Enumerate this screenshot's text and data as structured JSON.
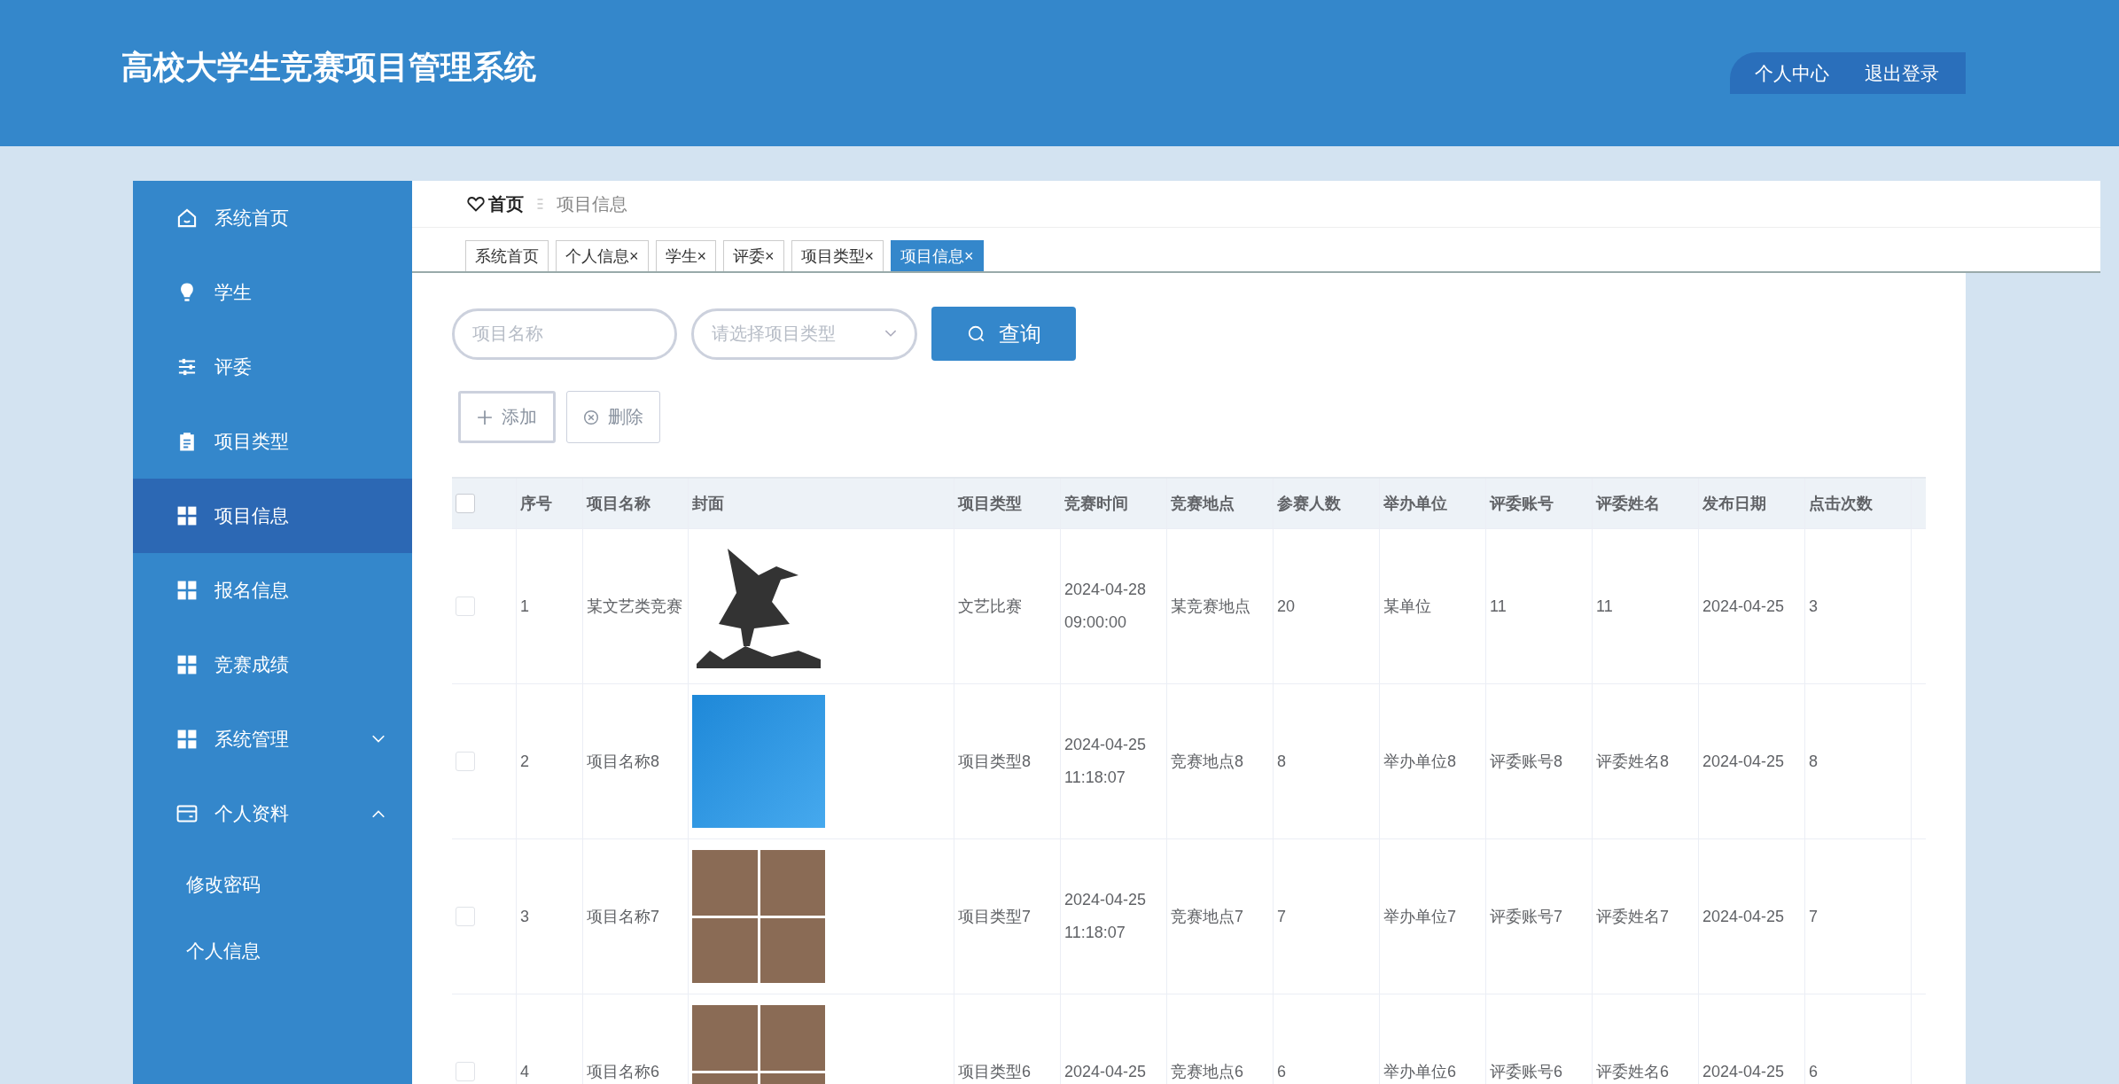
{
  "header": {
    "title": "高校大学生竞赛项目管理系统",
    "links": [
      "个人中心",
      "退出登录"
    ]
  },
  "sidebar": {
    "items": [
      {
        "label": "系统首页",
        "kind": "home",
        "selected": false
      },
      {
        "label": "学生",
        "kind": "bulb",
        "selected": false
      },
      {
        "label": "评委",
        "kind": "sliders",
        "selected": false
      },
      {
        "label": "项目类型",
        "kind": "clipboard",
        "selected": false
      },
      {
        "label": "项目信息",
        "kind": "grid",
        "selected": true
      },
      {
        "label": "报名信息",
        "kind": "grid",
        "selected": false
      },
      {
        "label": "竞赛成绩",
        "kind": "grid",
        "selected": false
      },
      {
        "label": "系统管理",
        "kind": "grid",
        "selected": false,
        "expanded": false
      },
      {
        "label": "个人资料",
        "kind": "card",
        "selected": false,
        "expanded": true,
        "children": [
          {
            "label": "修改密码",
            "selected": false
          },
          {
            "label": "个人信息",
            "selected": false
          }
        ]
      }
    ]
  },
  "breadcrumb": {
    "home": "首页",
    "current": "项目信息"
  },
  "tabs": [
    {
      "label": "系统首页",
      "closable": false,
      "selected": false
    },
    {
      "label": "个人信息",
      "closable": true,
      "selected": false
    },
    {
      "label": "学生",
      "closable": true,
      "selected": false
    },
    {
      "label": "评委",
      "closable": true,
      "selected": false
    },
    {
      "label": "项目类型",
      "closable": true,
      "selected": false
    },
    {
      "label": "项目信息",
      "closable": true,
      "selected": true
    }
  ],
  "tab_close_mark": "×",
  "search": {
    "name_placeholder": "项目名称",
    "type_placeholder": "请选择项目类型",
    "button": "查询"
  },
  "actions": [
    "添加",
    "删除"
  ],
  "table": {
    "header_checked": false,
    "columns": [
      "序号",
      "项目名称",
      "封面",
      "项目类型",
      "竞赛时间",
      "竞赛地点",
      "参赛人数",
      "举办单位",
      "评委账号",
      "评委姓名",
      "发布日期",
      "点击次数"
    ],
    "rows": [
      {
        "checked": false,
        "kind": "silhouette",
        "cells": [
          "1",
          "某文艺类竞赛",
          "",
          "文艺比赛",
          [
            "2024-04-28",
            "09:00:00"
          ],
          "某竞赛地点",
          "20",
          "某单位",
          "11",
          "11",
          "2024-04-25",
          "3"
        ]
      },
      {
        "checked": false,
        "kind": "photo",
        "cells": [
          "2",
          "项目名称8",
          "",
          "项目类型8",
          [
            "2024-04-25",
            "11:18:07"
          ],
          "竞赛地点8",
          "8",
          "举办单位8",
          "评委账号8",
          "评委姓名8",
          "2024-04-25",
          "8"
        ]
      },
      {
        "checked": false,
        "kind": "collage",
        "cells": [
          "3",
          "项目名称7",
          "",
          "项目类型7",
          [
            "2024-04-25",
            "11:18:07"
          ],
          "竞赛地点7",
          "7",
          "举办单位7",
          "评委账号7",
          "评委姓名7",
          "2024-04-25",
          "7"
        ]
      },
      {
        "checked": false,
        "kind": "collage",
        "cells": [
          "4",
          "项目名称6",
          "",
          "项目类型6",
          [
            "2024-04-25"
          ],
          "竞赛地点6",
          "6",
          "举办单位6",
          "评委账号6",
          "评委姓名6",
          "2024-04-25",
          "6"
        ]
      }
    ]
  }
}
